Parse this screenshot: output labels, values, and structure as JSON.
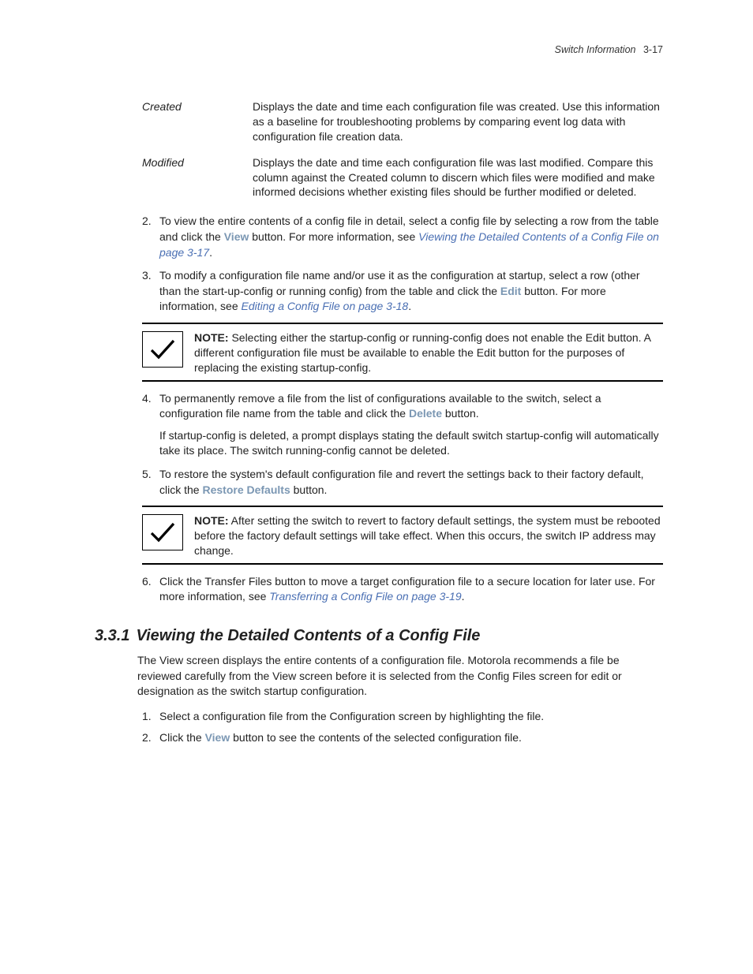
{
  "header": {
    "title": "Switch Information",
    "page": "3-17"
  },
  "defs": {
    "created": {
      "term": "Created",
      "body": "Displays the date and time each configuration file was created. Use this information as a baseline for troubleshooting problems by comparing event log data with configuration file creation data."
    },
    "modified": {
      "term": "Modified",
      "body": "Displays the date and time each configuration file was last modified. Compare this column against the Created column to discern which files were modified and make informed decisions whether existing files should be further modified or deleted."
    }
  },
  "steps": {
    "s2": {
      "pre": "To view the entire contents of a config file in detail, select a config file by selecting a row from the table and click the ",
      "btn": "View",
      "mid": " button. For more information, see ",
      "link": "Viewing the Detailed Contents of a Config File on page 3-17",
      "post": "."
    },
    "s3": {
      "pre": "To modify a configuration file name and/or use it as the configuration at startup, select a row (other than the start-up-config or running config) from the table and click the ",
      "btn": "Edit",
      "mid": " button. For more information, see ",
      "link": "Editing a Config File on page 3-18",
      "post": "."
    },
    "s4": {
      "pre": "To permanently remove a file from the list of configurations available to the switch, select a configuration file name from the table and click the ",
      "btn": "Delete",
      "post": " button.",
      "follow": "If startup-config is deleted, a prompt displays stating the default switch startup-config will automatically take its place. The switch running-config cannot be deleted."
    },
    "s5": {
      "pre": "To restore the system's default configuration file and revert the settings back to their factory default, click the ",
      "btn": "Restore Defaults",
      "post": " button."
    },
    "s6": {
      "pre": "Click the Transfer Files button to move a target configuration file to a secure location for later use. For more information, see ",
      "link": "Transferring a Config File on page 3-19",
      "post": "."
    }
  },
  "notes": {
    "n1": {
      "label": "NOTE:",
      "body": " Selecting either the startup-config or running-config does not enable the Edit button. A different configuration file must be available to enable the Edit button for the purposes of replacing the existing startup-config."
    },
    "n2": {
      "label": "NOTE:",
      "body": "  After setting the switch to revert to factory default settings, the system must be rebooted before the factory default settings will take effect. When this occurs, the switch IP address may change."
    }
  },
  "section": {
    "num": "3.3.1",
    "title": "Viewing the Detailed Contents of a Config File",
    "intro": "The View screen displays the entire contents of a configuration file. Motorola recommends a file be reviewed carefully from the View screen before it is selected from the Config Files screen for edit or designation as the switch startup configuration.",
    "steps": {
      "a": "Select a configuration file from the Configuration screen by highlighting the file.",
      "b_pre": "Click the ",
      "b_btn": "View",
      "b_post": " button to see the contents of the selected configuration file."
    }
  }
}
